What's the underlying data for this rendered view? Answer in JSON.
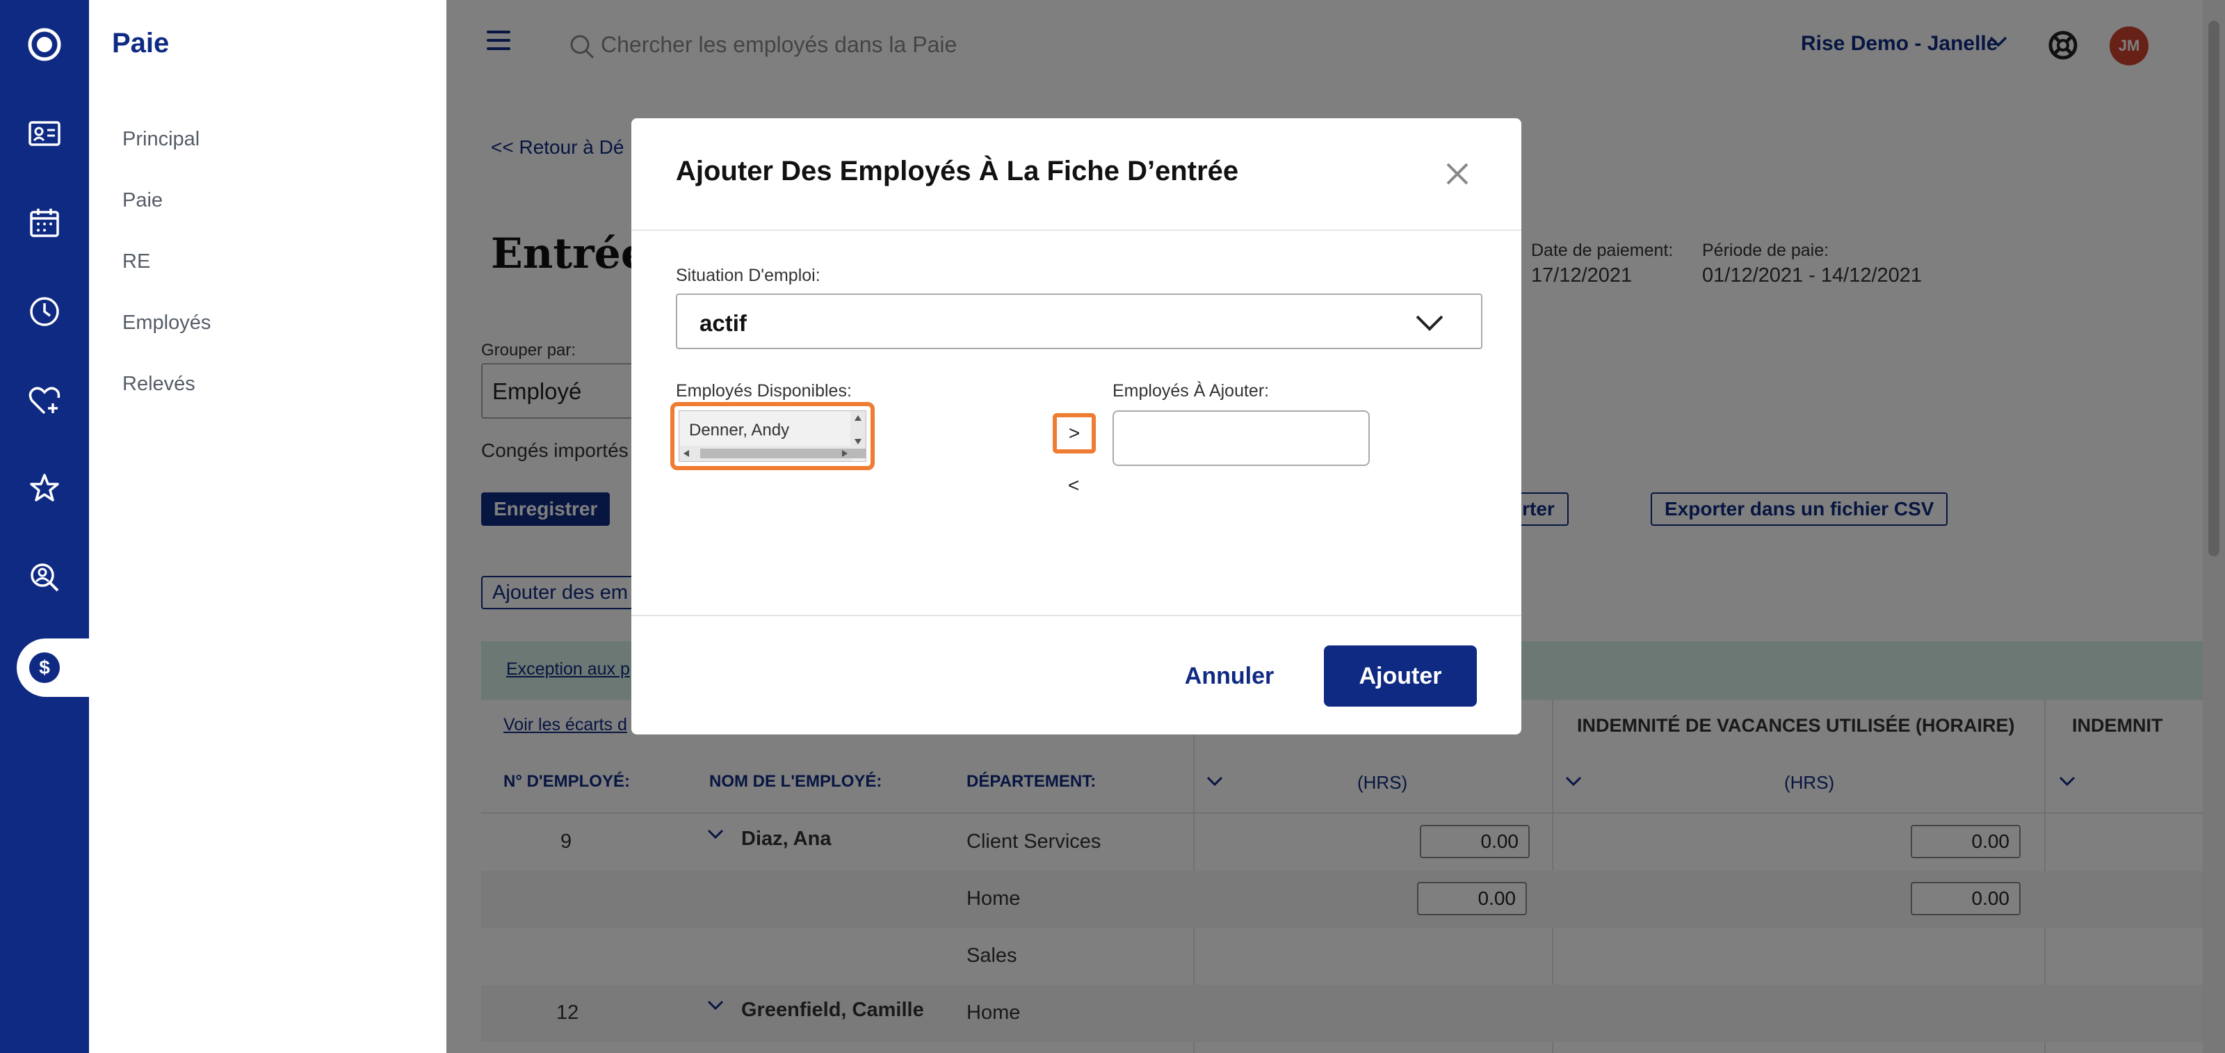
{
  "rail": {
    "icons": [
      "logo-icon",
      "id-card-icon",
      "calendar-icon",
      "clock-icon",
      "heart-plus-icon",
      "star-icon",
      "person-search-icon",
      "dollar-icon"
    ]
  },
  "sidenav": {
    "title": "Paie",
    "items": [
      "Principal",
      "Paie",
      "RE",
      "Employés",
      "Relevés"
    ]
  },
  "topbar": {
    "search_placeholder": "Chercher les employés dans la Paie",
    "company": "Rise Demo - Janelle",
    "avatar_initials": "JM"
  },
  "page": {
    "back_link": "<< Retour à Dé",
    "title": "Entrée",
    "date_label": "Date de paiement:",
    "date_value": "17/12/2021",
    "period_label": "Période de paie:",
    "period_value": "01/12/2021 - 14/12/2021",
    "group_label": "Grouper par:",
    "group_value": "Employé",
    "conges": "Congés importés",
    "save_button": "Enregistrer",
    "import_button": "mporter",
    "export_button": "Exporter dans un fichier CSV",
    "add_employees_button": "Ajouter des em",
    "exception_link": "Exception aux p",
    "voir_link": "Voir les écarts d",
    "col_vacation": "INDEMNITÉ DE VACANCES UTILISÉE (HORAIRE)",
    "col_indemnit": "INDEMNIT",
    "th_num": "N° D'EMPLOYÉ:",
    "th_name": "NOM DE L'EMPLOYÉ:",
    "th_dept": "DÉPARTEMENT:",
    "th_hrs": "(HRS)"
  },
  "rows": [
    {
      "num": "9",
      "name": "Diaz, Ana",
      "dept": "Client Services",
      "v1": "0.00",
      "v2": "0.00"
    },
    {
      "num": "",
      "name": "",
      "dept": "Home",
      "v1": "0.00",
      "v2": "0.00"
    },
    {
      "num": "",
      "name": "",
      "dept": "Sales",
      "v1": "",
      "v2": ""
    },
    {
      "num": "12",
      "name": "Greenfield, Camille",
      "dept": "Home",
      "v1": "",
      "v2": ""
    }
  ],
  "modal": {
    "title": "Ajouter Des Employés À La Fiche D’entrée",
    "status_label": "Situation D'emploi:",
    "status_value": "actif",
    "available_label": "Employés Disponibles:",
    "available_option": "Denner, Andy",
    "to_add_label": "Employés À Ajouter:",
    "move_right": ">",
    "move_left": "<",
    "cancel_button": "Annuler",
    "add_button": "Ajouter"
  },
  "colors": {
    "brand": "#0f2a83",
    "highlight": "#ef7c33",
    "green_band": "#d7f1e6"
  }
}
